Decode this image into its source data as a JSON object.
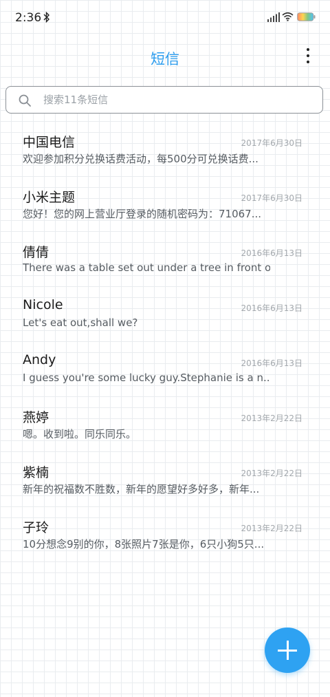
{
  "status_bar": {
    "time": "2:36",
    "icons": [
      "bluetooth-icon",
      "signal-icon",
      "wifi-icon",
      "battery-icon"
    ]
  },
  "header": {
    "title": "短信",
    "menu_icon": "more-vert-icon"
  },
  "search": {
    "placeholder": "搜索11条短信",
    "value": ""
  },
  "conversations": [
    {
      "name": "中国电信",
      "date": "2017年6月30日",
      "preview": "欢迎参加积分兑换话费活动，每500分可兑换话费..."
    },
    {
      "name": "小米主题",
      "date": "2017年6月30日",
      "preview": "您好！您的网上营业厅登录的随机密码为：71067..."
    },
    {
      "name": "倩倩",
      "date": "2016年6月13日",
      "preview": "There was a table set out under a tree in front o..."
    },
    {
      "name": "Nicole",
      "date": "2016年6月13日",
      "preview": "Let's eat out,shall we?"
    },
    {
      "name": "Andy",
      "date": "2016年6月13日",
      "preview": "I guess you're some lucky guy.Stephanie is a n..."
    },
    {
      "name": "燕婷",
      "date": "2013年2月22日",
      "preview": "嗯。收到啦。同乐同乐。"
    },
    {
      "name": "紫楠",
      "date": "2013年2月22日",
      "preview": "新年的祝福数不胜数，新年的愿望好多好多，新年..."
    },
    {
      "name": "子玲",
      "date": "2013年2月22日",
      "preview": "10分想念9别的你，8张照片7张是你，6只小狗5只..."
    }
  ],
  "fab": {
    "icon": "plus-icon"
  },
  "colors": {
    "accent": "#2b9cee",
    "fab": "#2ea2f2",
    "grid": "#e9ecef"
  }
}
